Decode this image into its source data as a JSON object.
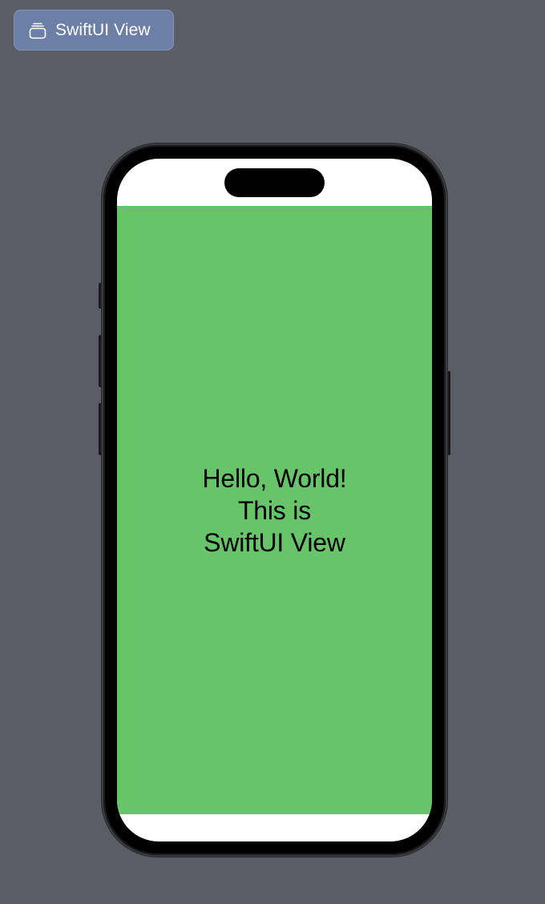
{
  "toolbar": {
    "preview_label": "SwiftUI View",
    "preview_icon": "stacked-squares-icon"
  },
  "device": {
    "screen": {
      "background_color": "#67C469",
      "text_lines": [
        "Hello, World!",
        "This is",
        "SwiftUI View"
      ]
    }
  },
  "colors": {
    "canvas_background": "#5A5D64",
    "badge_background": "#6C7FA7",
    "safe_area_background": "#FFFFFF"
  }
}
